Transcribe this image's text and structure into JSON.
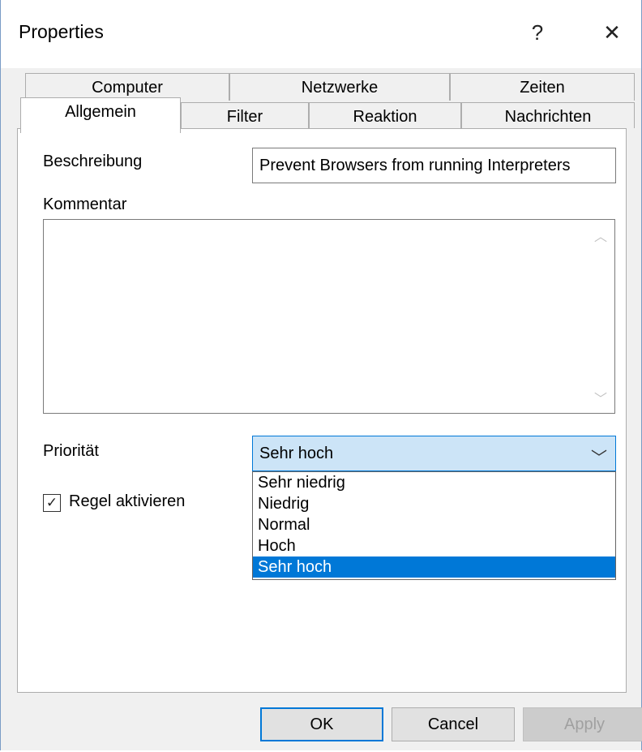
{
  "window": {
    "title": "Properties",
    "help_label": "?",
    "close_label": "✕"
  },
  "tabs": {
    "row1": [
      "Computer",
      "Netzwerke",
      "Zeiten"
    ],
    "row2": [
      "Allgemein",
      "Filter",
      "Reaktion",
      "Nachrichten"
    ],
    "active": "Allgemein"
  },
  "form": {
    "description_label": "Beschreibung",
    "description_value": "Prevent Browsers from running Interpreters",
    "comment_label": "Kommentar",
    "comment_value": "",
    "priority_label": "Priorität",
    "priority_value": "Sehr hoch",
    "priority_options": [
      "Sehr niedrig",
      "Niedrig",
      "Normal",
      "Hoch",
      "Sehr hoch"
    ],
    "enable_label": "Regel aktivieren",
    "enable_checked": true
  },
  "buttons": {
    "ok": "OK",
    "cancel": "Cancel",
    "apply": "Apply"
  },
  "colors": {
    "accent": "#0078d7",
    "dropdown_highlight": "#cce4f7"
  }
}
